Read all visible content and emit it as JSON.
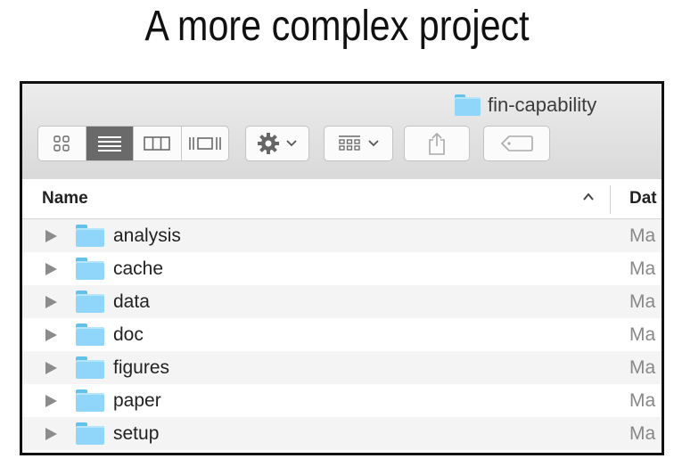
{
  "slide": {
    "title": "A more complex project"
  },
  "window": {
    "title": "fin-capability"
  },
  "toolbar": {
    "view_buttons": [
      "icon-view",
      "list-view",
      "column-view",
      "cover-flow-view"
    ],
    "active_view": "list-view"
  },
  "header": {
    "name_label": "Name",
    "date_label": "Dat",
    "sort": "ascending"
  },
  "rows": [
    {
      "name": "analysis",
      "date": "Ma"
    },
    {
      "name": "cache",
      "date": "Ma"
    },
    {
      "name": "data",
      "date": "Ma"
    },
    {
      "name": "doc",
      "date": "Ma"
    },
    {
      "name": "figures",
      "date": "Ma"
    },
    {
      "name": "paper",
      "date": "Ma"
    },
    {
      "name": "setup",
      "date": "Ma"
    }
  ],
  "colors": {
    "folder": "#8fd6fa",
    "folder_tab": "#62c2ee",
    "active_view_bg": "#6a6a6a"
  }
}
